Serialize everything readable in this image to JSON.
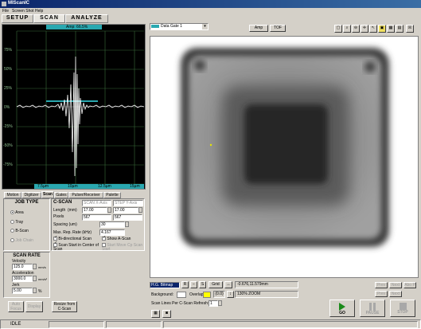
{
  "window": {
    "title": "MIScanIC"
  },
  "menu": {
    "items": [
      "File",
      "Screen Shot",
      "Help"
    ]
  },
  "main_tabs": [
    "SETUP",
    "SCAN",
    "ANALYZE"
  ],
  "ascan": {
    "gate_label": "Amp: 66.5%",
    "y_ticks": [
      "75%",
      "50%",
      "25%",
      "0%",
      "-25%",
      "-50%",
      "-75%"
    ],
    "x_ticks": [
      "7.5µm",
      "10µm",
      "12.5µm",
      "15µm"
    ]
  },
  "lower_tabs": [
    "Motion",
    "Digitizer",
    "Scan",
    "Gates",
    "Pulser/Receiver",
    "Palette"
  ],
  "job_type": {
    "title": "JOB TYPE",
    "options": [
      "Area",
      "Tray",
      "B-Scan",
      "Job Chain"
    ],
    "selected": "Area"
  },
  "cscan": {
    "title": "C-SCAN",
    "mode_select": "SCAN X-Axis",
    "step_select": "STEP Y-Axis",
    "length_label": "Length",
    "length_unit": "(mm)",
    "length_values": [
      "17.00",
      "17.00"
    ],
    "pixels_label": "Pixels",
    "pixels_values": [
      "567",
      "567"
    ],
    "spacing_label": "Spacing (um)",
    "spacing_value": "30",
    "rep_label": "Max. Rep. Rate (kHz)",
    "rep_value": "4.167",
    "bidir_label": "Bi-directional Scan",
    "show_ascan_label": "Show A-Scan",
    "start_center_label": "Scan Start in Center of Scan",
    "start_move_label": "Start Move Cp Scan Start"
  },
  "scan_rate": {
    "title": "SCAN RATE",
    "velocity_label": "Velocity",
    "velocity_value": "125.0",
    "velocity_unit": "mm/s",
    "accel_label": "Acceleration",
    "accel_value": "3000.0",
    "accel_unit": "mm/s²",
    "jerk_label": "Jerk",
    "jerk_value": "5.00",
    "jerk_unit": "%"
  },
  "left_buttons": {
    "auto_focus": "Auto Focus",
    "display": "Display",
    "resize": "Resize from C-Scan"
  },
  "image_view": {
    "data_select": "Data Gate 1",
    "amp_button": "Amp",
    "tof_button": "TOF"
  },
  "bottom": {
    "gate_select": "H.G. Bitmap",
    "r_button": "R",
    "minus_button": "−",
    "s_button": "S",
    "grid_button": "Grid",
    "coords": "-0.676,11.579mm",
    "zoom": "130% ZOOM",
    "background_label": "Background:",
    "overlap_label": "Overlap:",
    "overlap_value": "(0.0)",
    "refresh_label": "Scan Lines Per C-Scan Refresh:",
    "refresh_value": "1",
    "go_label": "GO",
    "pause_label": "PAUSE",
    "stop_label": "STOP",
    "nav_buttons": [
      "Prev",
      "Next",
      "Abo P",
      "Prev",
      "Next"
    ]
  },
  "status": {
    "text": "IDLE"
  },
  "colors": {
    "title_bar": "#0a246a",
    "plot_bg": "#000000",
    "plot_grid": "#3a6a3a",
    "signal": "#ffffff",
    "gate": "#2aa8b0",
    "go": "#1a8a1a"
  }
}
